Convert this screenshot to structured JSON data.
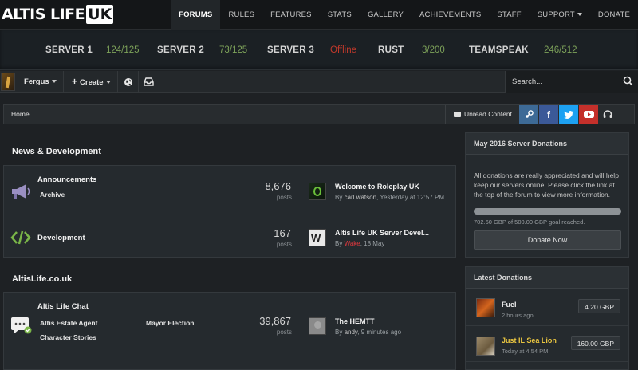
{
  "brand": {
    "logo_main": "ALTIS LIFE",
    "logo_box": "UK"
  },
  "nav": {
    "items": [
      {
        "label": "FORUMS",
        "active": true
      },
      {
        "label": "RULES"
      },
      {
        "label": "FEATURES"
      },
      {
        "label": "STATS"
      },
      {
        "label": "GALLERY"
      },
      {
        "label": "ACHIEVEMENTS"
      },
      {
        "label": "STAFF"
      },
      {
        "label": "SUPPORT"
      },
      {
        "label": "DONATE"
      }
    ]
  },
  "servers": [
    {
      "name": "SERVER 1",
      "status": "124/125",
      "color": "#7ea35a"
    },
    {
      "name": "SERVER 2",
      "status": "73/125",
      "color": "#7ea35a"
    },
    {
      "name": "SERVER 3",
      "status": "Offline",
      "color": "#c0392b"
    },
    {
      "name": "RUST",
      "status": "3/200",
      "color": "#7ea35a"
    },
    {
      "name": "TEAMSPEAK",
      "status": "246/512",
      "color": "#7ea35a"
    }
  ],
  "userbar": {
    "username": "Fergus",
    "create_label": "Create",
    "search_placeholder": "Search..."
  },
  "breadcrumb": {
    "home": "Home",
    "unread": "Unread Content"
  },
  "social": [
    {
      "icon": "steam-icon",
      "color": "#3d6a96"
    },
    {
      "icon": "facebook-icon",
      "color": "#3b5998"
    },
    {
      "icon": "twitter-icon",
      "color": "#1da1f2"
    },
    {
      "icon": "youtube-icon",
      "color": "#c4302b"
    },
    {
      "icon": "headset-icon",
      "color": "#2a2e31"
    }
  ],
  "sections": [
    {
      "title": "News & Development",
      "forums": [
        {
          "title": "Announcements",
          "subforums": [
            "Archive"
          ],
          "count": "8,676",
          "posts_label": "posts",
          "last_title": "Welcome to Roleplay UK",
          "last_by": "By",
          "last_user": "carl watson",
          "last_time": ", Yesterday at 12:57 PM"
        },
        {
          "title": "Development",
          "subforums": [],
          "count": "167",
          "posts_label": "posts",
          "last_title": "Altis Life UK Server Devel...",
          "last_by": "By",
          "last_user": "Wake",
          "last_time": ", 18 May"
        }
      ]
    },
    {
      "title": "AltisLife.co.uk",
      "forums": [
        {
          "title": "Altis Life Chat",
          "subforums": [
            "Altis Estate Agent",
            "Mayor Election",
            "Character Stories"
          ],
          "count": "39,867",
          "posts_label": "posts",
          "last_title": "The HEMTT",
          "last_by": "By",
          "last_user": "andy",
          "last_time": ", 9 minutes ago"
        }
      ]
    }
  ],
  "donations_widget": {
    "title": "May 2016 Server Donations",
    "text": "All donations are really appreciated and will help keep our servers online. Please click the link at the top of the forum to view more information.",
    "progress": 1.0,
    "goal_text": "702.60 GBP of 500.00 GBP goal reached.",
    "button": "Donate Now"
  },
  "latest_donations": {
    "title": "Latest Donations",
    "items": [
      {
        "name": "Fuel",
        "time": "2 hours ago",
        "amount": "4.20 GBP",
        "name_color": "#f0f0f0"
      },
      {
        "name": "Just IL Sea Lion",
        "time": "Today at 4:54 PM",
        "amount": "160.00 GBP",
        "name_color": "#e8c440"
      }
    ]
  },
  "colors": {
    "accent_red": "#e0383e",
    "online": "#7ea35a",
    "offline": "#c0392b"
  }
}
